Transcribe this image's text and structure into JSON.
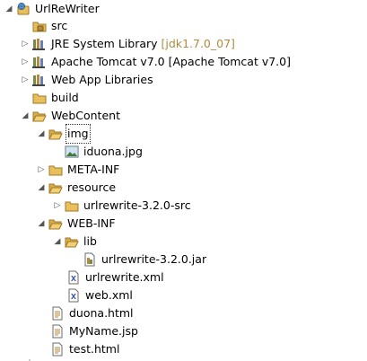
{
  "project_explorer": {
    "project": "UrlReWriter",
    "src": "src",
    "jre_library": "JRE System Library",
    "jre_decoration": "[jdk1.7.0_07]",
    "tomcat": "Apache Tomcat v7.0 [Apache Tomcat v7.0]",
    "web_app_libraries": "Web App Libraries",
    "build": "build",
    "webcontent": "WebContent",
    "img": "img",
    "iduona": "iduona.jpg",
    "meta_inf": "META-INF",
    "resource": "resource",
    "urlrewrite_src": "urlrewrite-3.2.0-src",
    "web_inf": "WEB-INF",
    "lib": "lib",
    "urlrewrite_jar": "urlrewrite-3.2.0.jar",
    "urlrewrite_xml": "urlrewrite.xml",
    "web_xml": "web.xml",
    "duona_html": "duona.html",
    "myname_jsp": "MyName.jsp",
    "test_html": "test.html"
  },
  "colors": {
    "folder": "#e8bf5a",
    "package": "#b58b3e",
    "jar": "#7a8a4a",
    "decoration": "#b08a3e",
    "xml": "#3b5ea8"
  },
  "icons": {
    "expanded": "triangle-down",
    "collapsed": "triangle-right"
  }
}
